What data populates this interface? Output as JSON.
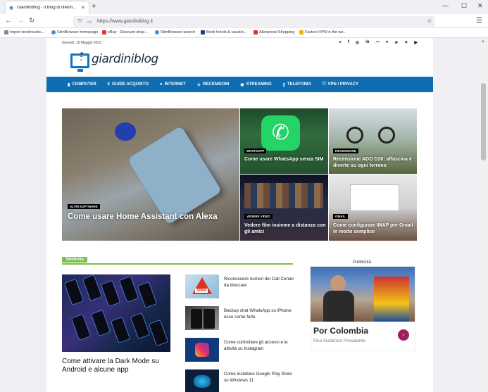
{
  "browser": {
    "tab_title": "GiardiniBlog - Il Blog di riferim...",
    "url": "https://www.giardiniblog.it",
    "bookmarks": [
      "Import bookmarks...",
      "SlimBrowser homepage",
      "eBay - Discount shop...",
      "SlimBrowser search",
      "Book hotels & vacatio...",
      "Aliexpress Shopping",
      "Fastest VPN in the wo..."
    ]
  },
  "site": {
    "date": "Giovedì, 19 Maggio 2022",
    "logo_text": "giardiniblog",
    "nav": [
      "COMPUTER",
      "GUIDE ACQUISTO",
      "INTERNET",
      "RECENSIONI",
      "STREAMING",
      "TELEFONIA",
      "VPN / PRIVACY"
    ]
  },
  "featured": [
    {
      "cat": "ALTRI SOFTWARE",
      "title": "Come usare Home Assistant con Alexa"
    },
    {
      "cat": "WHATSAPP",
      "title": "Come usare WhatsApp senza SIM"
    },
    {
      "cat": "RECENSIONE",
      "title": "Recensione ADO D30: affascina e diverte su ogni terreno"
    },
    {
      "cat": "VEDERE VIDEO",
      "title": "Vedere film insieme a distanza con gli amici"
    },
    {
      "cat": "GMAIL",
      "title": "Come configurare IMAP per Gmail in modo semplice"
    }
  ],
  "section": {
    "label": "Telefonia",
    "big_title": "Come attivare la Dark Mode su Android e alcune app",
    "list": [
      "Riconoscere numeri dei Call Center da bloccare",
      "Backup chat WhatsApp su iPhone: ecco come farlo",
      "Come controllare gli accessi e le attività su Instagram",
      "Come installare Google Play Store su Windows 11"
    ]
  },
  "ad": {
    "label": "Pubblicità",
    "headline": "Por Colombia",
    "sub": "Fico Gutiérrez Presidente",
    "button": "›"
  }
}
